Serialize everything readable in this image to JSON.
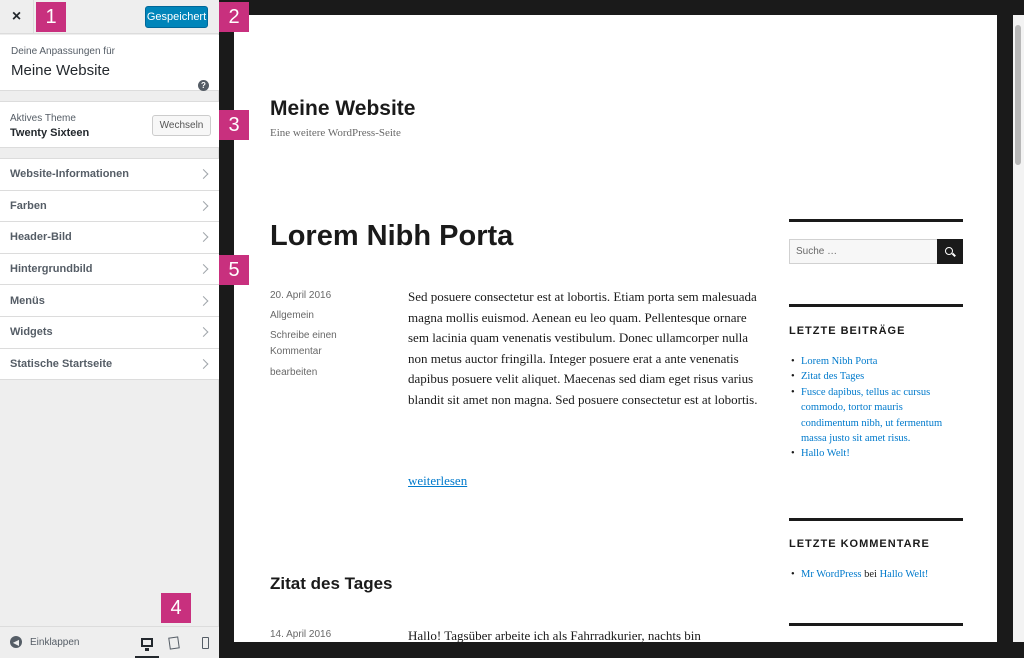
{
  "topbar": {
    "close_icon": "×",
    "save_label": "Gespeichert"
  },
  "info": {
    "label": "Deine Anpassungen für",
    "title": "Meine Website",
    "help_icon": "?"
  },
  "theme": {
    "label": "Aktives Theme",
    "name": "Twenty Sixteen",
    "switch_label": "Wechseln"
  },
  "menu": {
    "items": [
      {
        "label": "Website-Informationen"
      },
      {
        "label": "Farben"
      },
      {
        "label": "Header-Bild"
      },
      {
        "label": "Hintergrundbild"
      },
      {
        "label": "Menüs"
      },
      {
        "label": "Widgets"
      },
      {
        "label": "Statische Startseite"
      }
    ]
  },
  "footer": {
    "collapse_label": "Einklappen",
    "collapse_icon": "◀"
  },
  "site": {
    "title": "Meine Website",
    "tagline": "Eine weitere WordPress-Seite"
  },
  "post1": {
    "title": "Lorem Nibh Porta",
    "date": "20. April 2016",
    "category": "Allgemein",
    "comment": "Schreibe einen Kommentar",
    "edit": "bearbeiten",
    "body": "Sed posuere consectetur est at lobortis. Etiam porta sem malesuada magna mollis euismod. Aenean eu leo quam. Pellentesque ornare sem lacinia quam venenatis vestibulum. Donec ullamcorper nulla non metus auctor fringilla. Integer posuere erat a ante venenatis dapibus posuere velit aliquet. Maecenas sed diam eget risus varius blandit sit amet non magna. Sed posuere consectetur est at lobortis.",
    "more": "weiterlesen"
  },
  "post2": {
    "title": "Zitat des Tages",
    "date": "14. April 2016",
    "body": "Hallo! Tagsüber arbeite ich als Fahrradkurier, nachts bin"
  },
  "widgets": {
    "search_placeholder": "Suche …",
    "recent_posts_title": "LETZTE BEITRÄGE",
    "recent_posts": [
      "Lorem Nibh Porta",
      "Zitat des Tages",
      "Fusce dapibus, tellus ac cursus commodo, tortor mauris condimentum nibh, ut fermentum massa justo sit amet risus.",
      "Hallo Welt!"
    ],
    "recent_comments_title": "LETZTE KOMMENTARE",
    "comment": {
      "author": "Mr WordPress",
      "connector": "bei",
      "post": "Hallo Welt!"
    }
  },
  "markers": [
    "1",
    "2",
    "3",
    "4",
    "5"
  ],
  "colors": {
    "accent": "#0085ba",
    "link": "#007acc",
    "marker": "#c8307e"
  }
}
